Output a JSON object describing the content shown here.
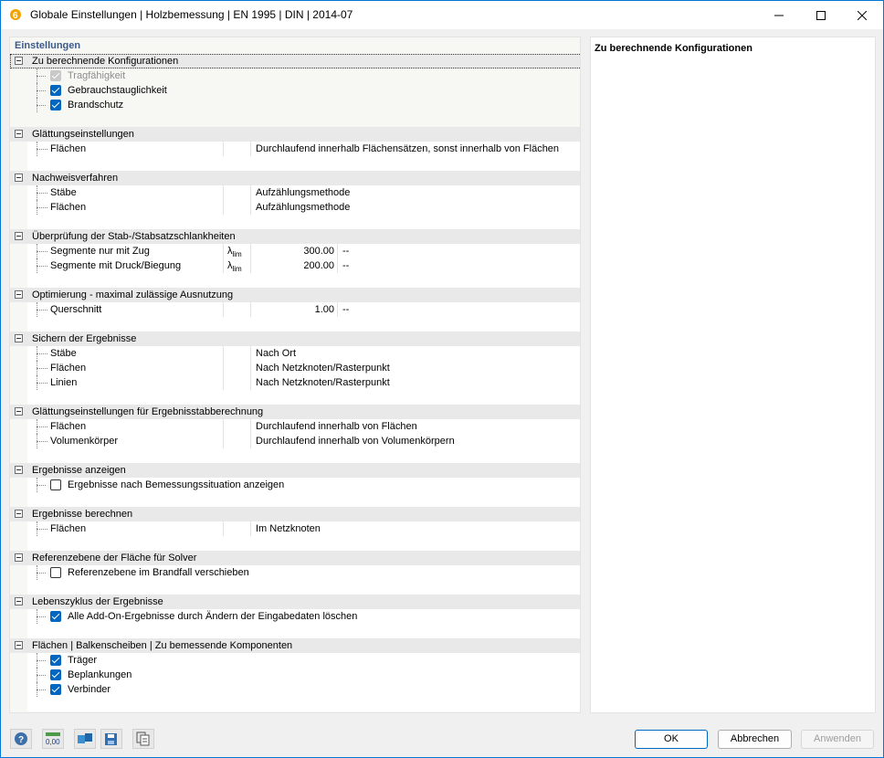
{
  "window": {
    "title": "Globale Einstellungen | Holzbemessung | EN 1995 | DIN | 2014-07"
  },
  "left_pane": {
    "header": "Einstellungen",
    "groups": [
      {
        "label": "Zu berechnende Konfigurationen",
        "items": [
          {
            "type": "checkbox",
            "label": "Tragfähigkeit",
            "checked": true,
            "disabled": true
          },
          {
            "type": "checkbox",
            "label": "Gebrauchstauglichkeit",
            "checked": true
          },
          {
            "type": "checkbox",
            "label": "Brandschutz",
            "checked": true
          }
        ]
      },
      {
        "label": "Glättungseinstellungen",
        "items": [
          {
            "type": "value",
            "label": "Flächen",
            "value": "Durchlaufend innerhalb Flächensätzen, sonst innerhalb von Flächen"
          }
        ]
      },
      {
        "label": "Nachweisverfahren",
        "items": [
          {
            "type": "value",
            "label": "Stäbe",
            "value": "Aufzählungsmethode"
          },
          {
            "type": "value",
            "label": "Flächen",
            "value": "Aufzählungsmethode"
          }
        ]
      },
      {
        "label": "Überprüfung der Stab-/Stabsatzschlankheiten",
        "items": [
          {
            "type": "number",
            "label": "Segmente nur mit Zug",
            "symbol": "λ",
            "symbol_sub": "lim",
            "value": "300.00",
            "unit": "--"
          },
          {
            "type": "number",
            "label": "Segmente mit Druck/Biegung",
            "symbol": "λ",
            "symbol_sub": "lim",
            "value": "200.00",
            "unit": "--"
          }
        ]
      },
      {
        "label": "Optimierung - maximal zulässige Ausnutzung",
        "items": [
          {
            "type": "number",
            "label": "Querschnitt",
            "symbol": "",
            "symbol_sub": "",
            "value": "1.00",
            "unit": "--"
          }
        ]
      },
      {
        "label": "Sichern der Ergebnisse",
        "items": [
          {
            "type": "value",
            "label": "Stäbe",
            "value": "Nach Ort"
          },
          {
            "type": "value",
            "label": "Flächen",
            "value": "Nach Netzknoten/Rasterpunkt"
          },
          {
            "type": "value",
            "label": "Linien",
            "value": "Nach Netzknoten/Rasterpunkt"
          }
        ]
      },
      {
        "label": "Glättungseinstellungen für Ergebnisstabberechnung",
        "items": [
          {
            "type": "value",
            "label": "Flächen",
            "value": "Durchlaufend innerhalb von Flächen"
          },
          {
            "type": "value",
            "label": "Volumenkörper",
            "value": "Durchlaufend innerhalb von Volumenkörpern"
          }
        ]
      },
      {
        "label": "Ergebnisse anzeigen",
        "items": [
          {
            "type": "checkbox",
            "label": "Ergebnisse nach Bemessungssituation anzeigen",
            "checked": false
          }
        ]
      },
      {
        "label": "Ergebnisse berechnen",
        "items": [
          {
            "type": "value",
            "label": "Flächen",
            "value": "Im Netzknoten"
          }
        ]
      },
      {
        "label": "Referenzebene der Fläche für Solver",
        "items": [
          {
            "type": "checkbox",
            "label": "Referenzebene im Brandfall verschieben",
            "checked": false
          }
        ]
      },
      {
        "label": "Lebenszyklus der Ergebnisse",
        "items": [
          {
            "type": "checkbox",
            "label": "Alle Add-On-Ergebnisse durch Ändern der Eingabedaten löschen",
            "checked": true
          }
        ]
      },
      {
        "label": "Flächen | Balkenscheiben | Zu bemessende Komponenten",
        "items": [
          {
            "type": "checkbox",
            "label": "Träger",
            "checked": true
          },
          {
            "type": "checkbox",
            "label": "Beplankungen",
            "checked": true
          },
          {
            "type": "checkbox",
            "label": "Verbinder",
            "checked": true
          }
        ]
      }
    ]
  },
  "right_pane": {
    "title": "Zu berechnende Konfigurationen"
  },
  "buttons": {
    "ok": "OK",
    "cancel": "Abbrechen",
    "apply": "Anwenden"
  },
  "toolbar_icons": [
    "help-icon",
    "units-icon",
    "import-icon",
    "save-icon",
    "copy-icon"
  ],
  "colors": {
    "accent": "#0067c0",
    "header_text": "#3c5a8a"
  }
}
